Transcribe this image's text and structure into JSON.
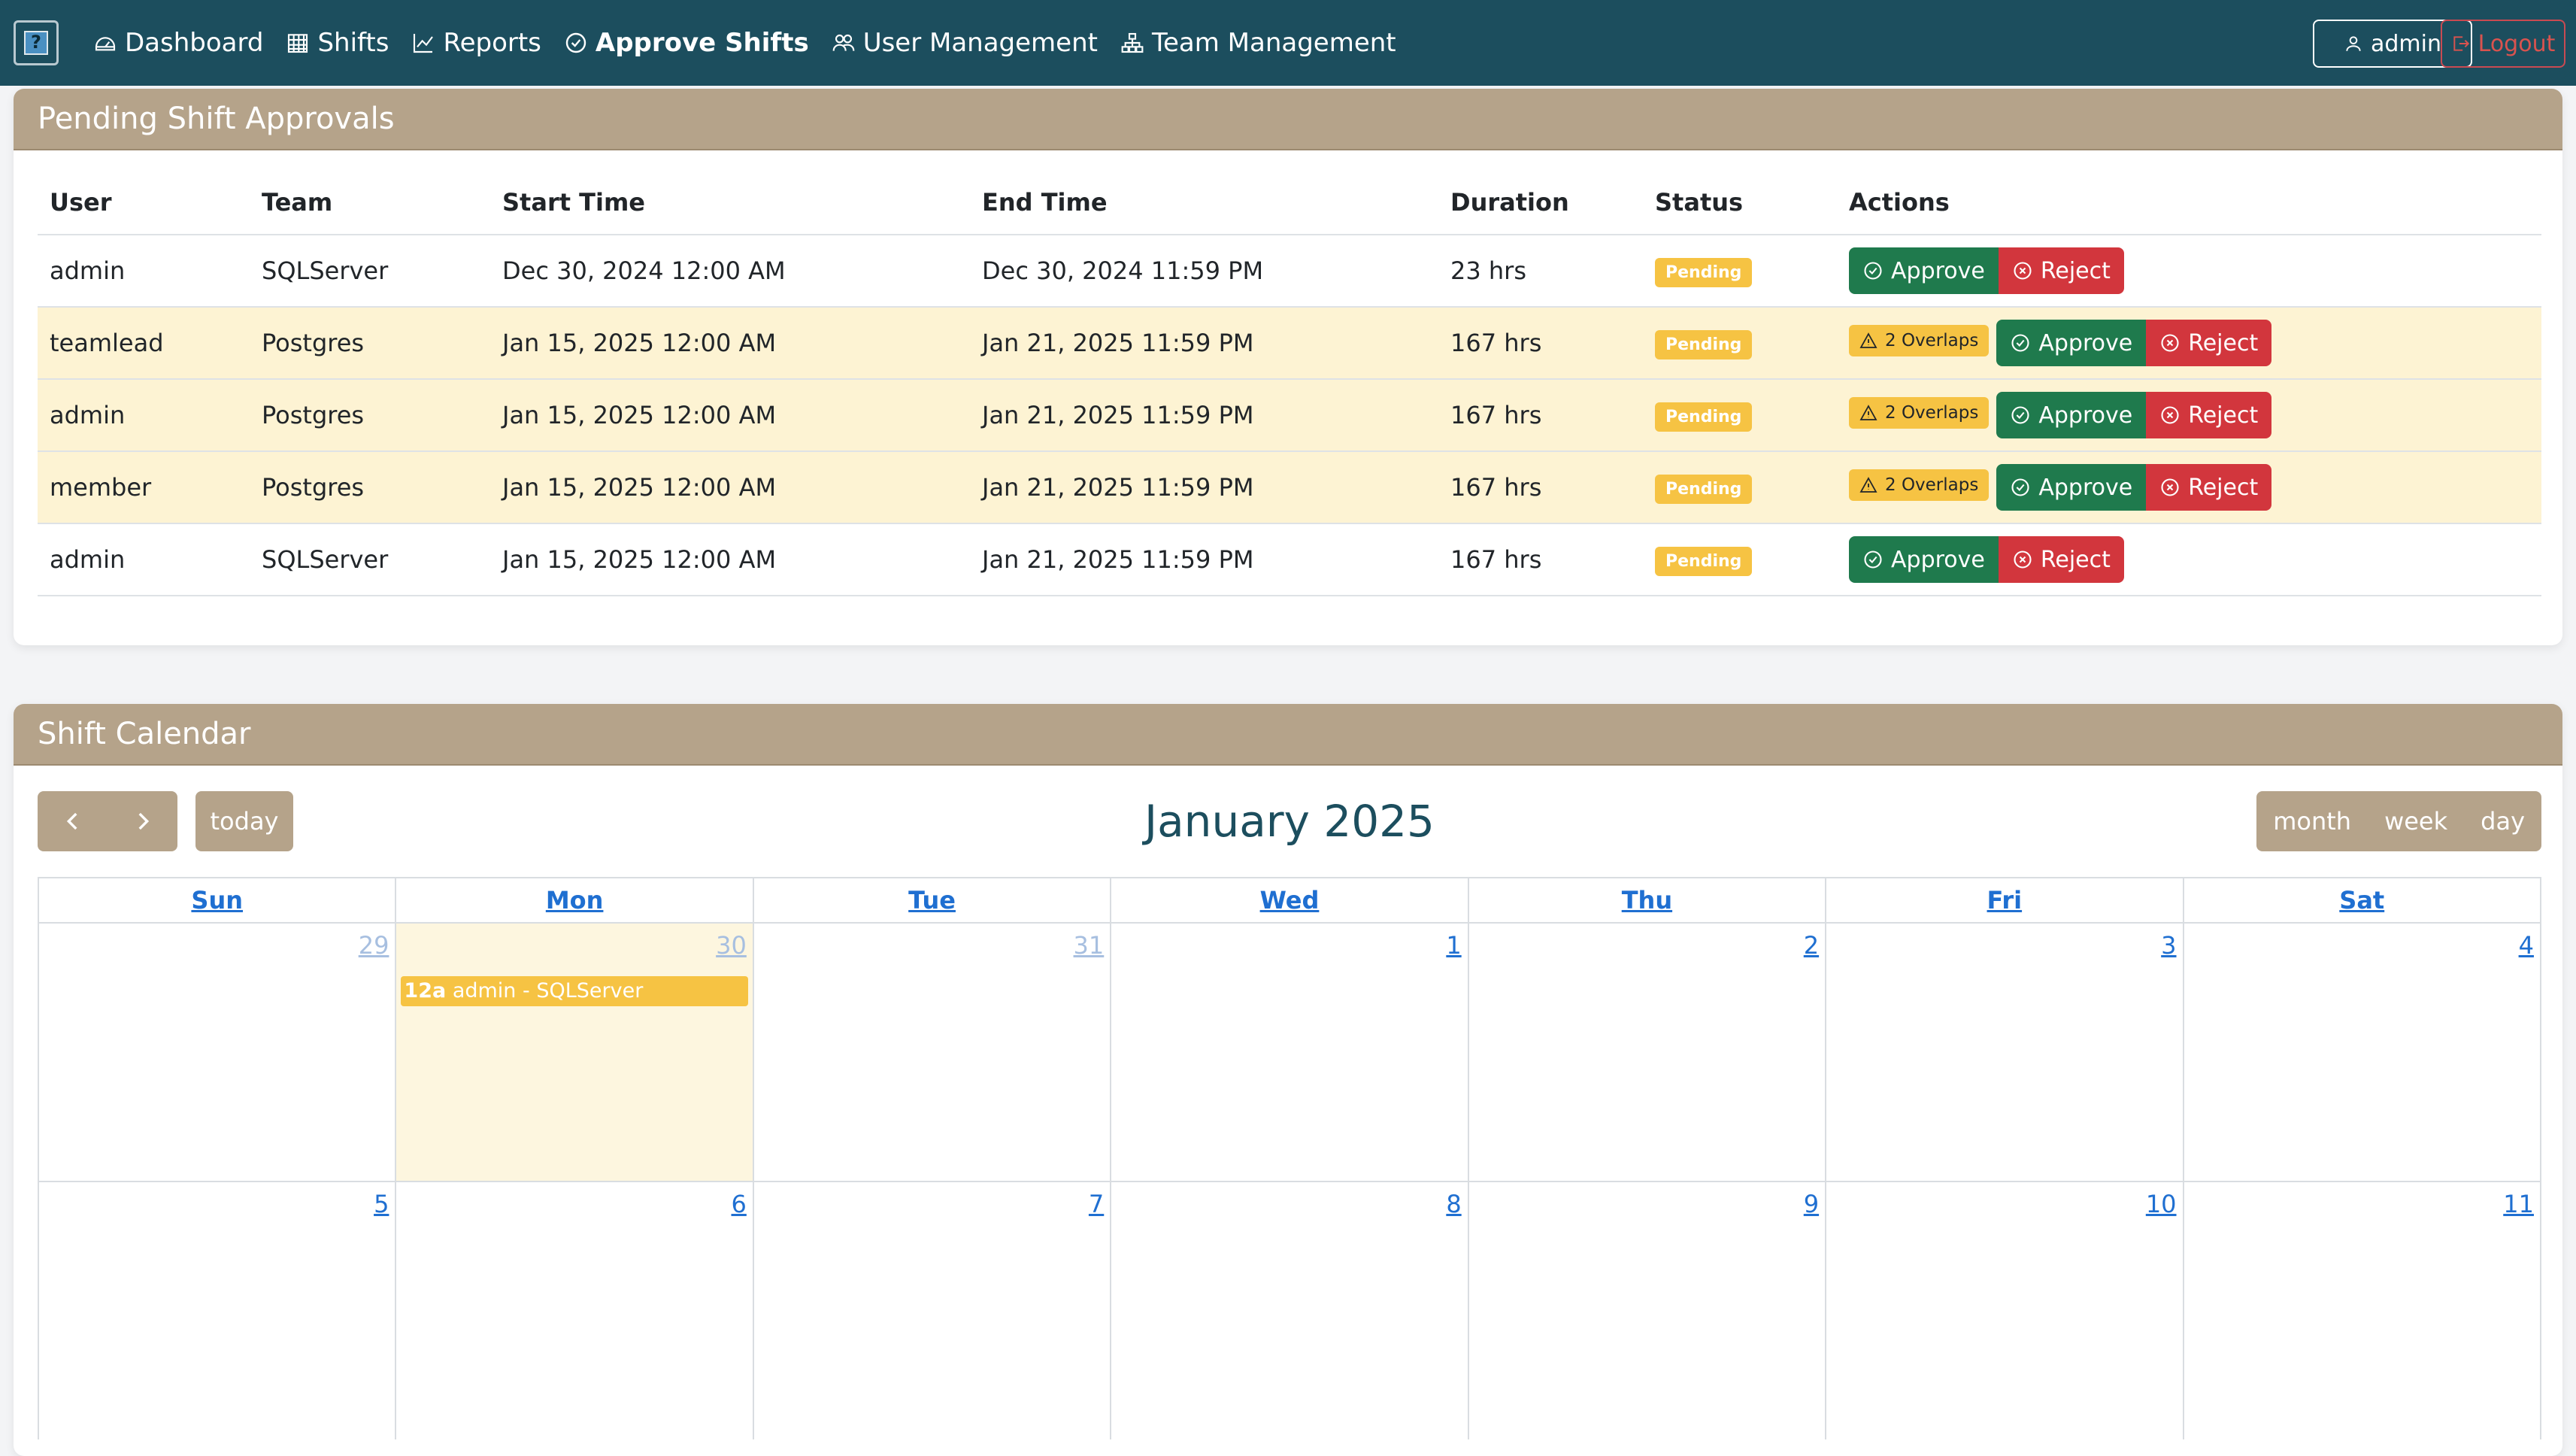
{
  "nav": {
    "items": [
      {
        "label": "Dashboard",
        "icon": "dashboard-icon"
      },
      {
        "label": "Shifts",
        "icon": "calendar-grid-icon"
      },
      {
        "label": "Reports",
        "icon": "chart-line-icon"
      },
      {
        "label": "Approve Shifts",
        "icon": "check-circle-icon",
        "active": true
      },
      {
        "label": "User Management",
        "icon": "users-icon"
      },
      {
        "label": "Team Management",
        "icon": "team-hierarchy-icon"
      }
    ],
    "user_label": "admin",
    "logout_label": "Logout"
  },
  "approvals": {
    "title": "Pending Shift Approvals",
    "columns": [
      "User",
      "Team",
      "Start Time",
      "End Time",
      "Duration",
      "Status",
      "Actions"
    ],
    "rows": [
      {
        "user": "admin",
        "team": "SQLServer",
        "start": "Dec 30, 2024 12:00 AM",
        "end": "Dec 30, 2024 11:59 PM",
        "duration": "23 hrs",
        "status": "Pending",
        "overlaps": ""
      },
      {
        "user": "teamlead",
        "team": "Postgres",
        "start": "Jan 15, 2025 12:00 AM",
        "end": "Jan 21, 2025 11:59 PM",
        "duration": "167 hrs",
        "status": "Pending",
        "overlaps": "2 Overlaps"
      },
      {
        "user": "admin",
        "team": "Postgres",
        "start": "Jan 15, 2025 12:00 AM",
        "end": "Jan 21, 2025 11:59 PM",
        "duration": "167 hrs",
        "status": "Pending",
        "overlaps": "2 Overlaps"
      },
      {
        "user": "member",
        "team": "Postgres",
        "start": "Jan 15, 2025 12:00 AM",
        "end": "Jan 21, 2025 11:59 PM",
        "duration": "167 hrs",
        "status": "Pending",
        "overlaps": "2 Overlaps"
      },
      {
        "user": "admin",
        "team": "SQLServer",
        "start": "Jan 15, 2025 12:00 AM",
        "end": "Jan 21, 2025 11:59 PM",
        "duration": "167 hrs",
        "status": "Pending",
        "overlaps": ""
      }
    ],
    "approve_label": "Approve",
    "reject_label": "Reject"
  },
  "calendar": {
    "title": "Shift Calendar",
    "month_label": "January 2025",
    "today_label": "today",
    "views": [
      "month",
      "week",
      "day"
    ],
    "weekdays": [
      "Sun",
      "Mon",
      "Tue",
      "Wed",
      "Thu",
      "Fri",
      "Sat"
    ],
    "weeks": [
      [
        {
          "n": "29",
          "other": true
        },
        {
          "n": "30",
          "other": true,
          "today": true
        },
        {
          "n": "31",
          "other": true
        },
        {
          "n": "1"
        },
        {
          "n": "2"
        },
        {
          "n": "3"
        },
        {
          "n": "4"
        }
      ],
      [
        {
          "n": "5"
        },
        {
          "n": "6"
        },
        {
          "n": "7"
        },
        {
          "n": "8"
        },
        {
          "n": "9"
        },
        {
          "n": "10"
        },
        {
          "n": "11"
        }
      ]
    ],
    "event": {
      "time": "12a",
      "text": "admin - SQLServer"
    }
  }
}
